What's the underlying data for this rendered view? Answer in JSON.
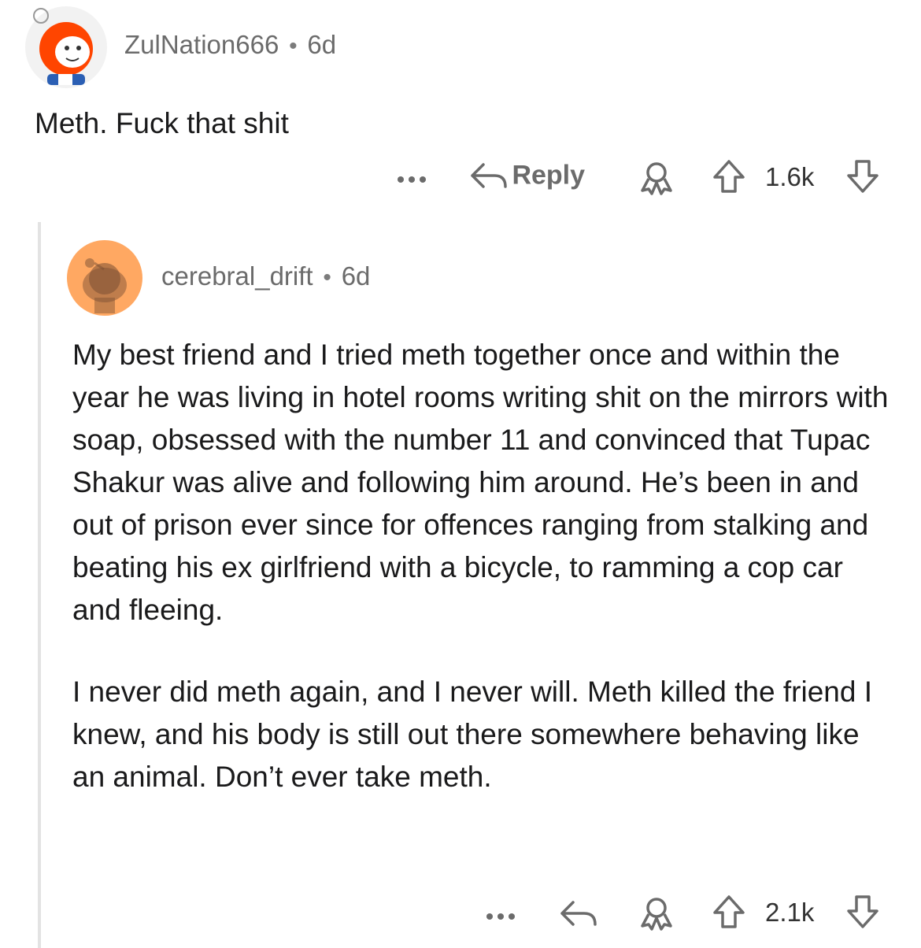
{
  "parent_comment": {
    "username": "ZulNation666",
    "age": "6d",
    "body": "Meth. Fuck that shit",
    "actions": {
      "reply_label": "Reply",
      "vote_count": "1.6k"
    }
  },
  "reply_comment": {
    "username": "cerebral_drift",
    "age": "6d",
    "paragraphs": [
      "My best friend and I tried meth together once and within the year he was living in hotel rooms writing shit on the mirrors with soap, obsessed with the number 11 and convinced that Tupac Shakur was alive and following him around. He’s been in and out of prison ever since for offences ranging from stalking and beating his ex girlfriend with a bicycle, to ramming a cop car and fleeing.",
      "I never did meth again, and I never will. Meth killed the friend I knew, and his body is still out there somewhere behaving like an animal. Don’t ever take meth."
    ],
    "actions": {
      "vote_count": "2.1k"
    }
  },
  "colors": {
    "meta_gray": "#6b6b6b",
    "thread_line": "#e3e3e3",
    "avatar1_orange": "#ff4500",
    "avatar2_orange": "#ffa862"
  },
  "icons": [
    "snoo-avatar",
    "more-icon",
    "reply-icon",
    "award-icon",
    "upvote-icon",
    "downvote-icon"
  ]
}
